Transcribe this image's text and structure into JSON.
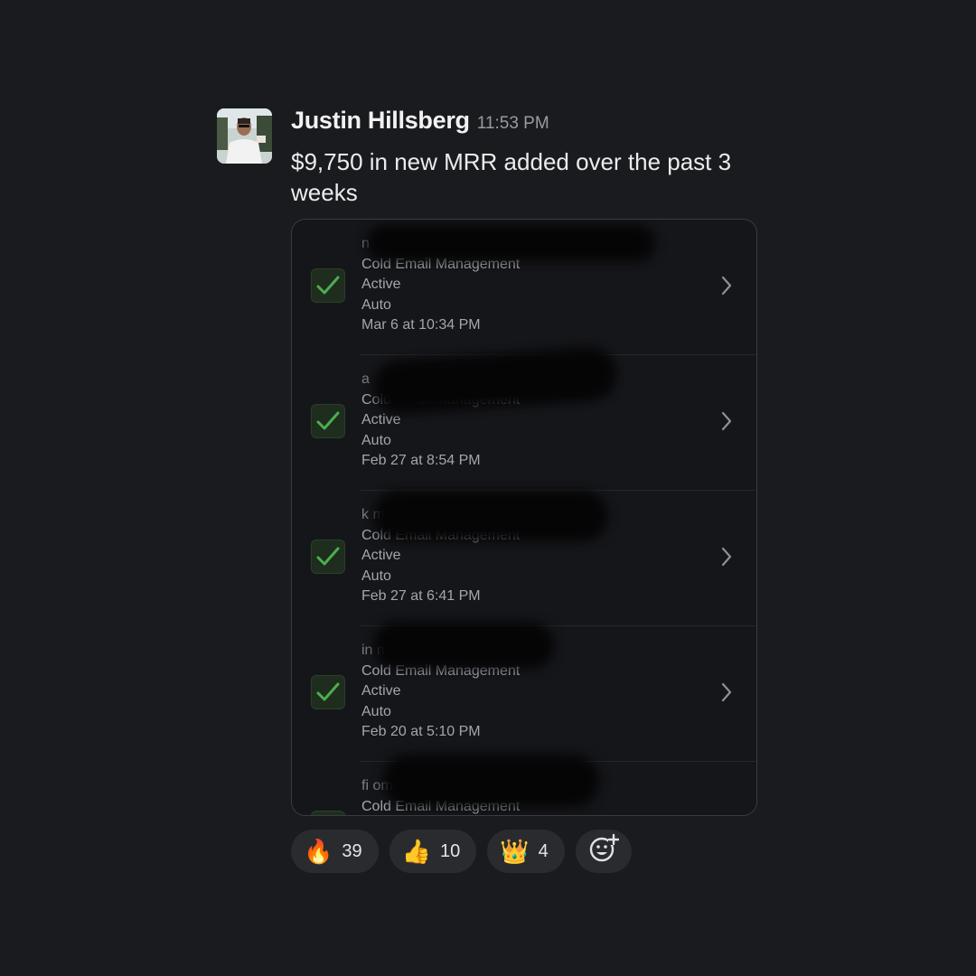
{
  "message": {
    "author": "Justin Hillsberg",
    "time": "11:53 PM",
    "text": "$9,750 in new MRR added over the past 3 weeks"
  },
  "attachment": {
    "rows": [
      {
        "email": "n",
        "service": "Cold Email Management",
        "status": "Active",
        "renewal": "Auto",
        "date": "Mar 6 at 10:34 PM"
      },
      {
        "email": "a",
        "service": "Cold Email Management",
        "status": "Active",
        "renewal": "Auto",
        "date": "Feb 27 at 8:54 PM"
      },
      {
        "email": "k                                            m",
        "service": "Cold Email Management",
        "status": "Active",
        "renewal": "Auto",
        "date": "Feb 27 at 6:41 PM"
      },
      {
        "email": "in                                      m",
        "service": "Cold Email Management",
        "status": "Active",
        "renewal": "Auto",
        "date": "Feb 20 at 5:10 PM"
      },
      {
        "email": "fi                                          om",
        "service": "Cold Email Management",
        "status": "",
        "renewal": "",
        "date": ""
      }
    ]
  },
  "reactions": [
    {
      "emoji": "🔥",
      "count": "39",
      "icon": "fire-icon"
    },
    {
      "emoji": "👍",
      "count": "10",
      "icon": "thumbs-up-icon"
    },
    {
      "emoji": "👑",
      "count": "4",
      "icon": "crown-icon"
    }
  ],
  "add_reaction_icon": "add-reaction-icon",
  "colors": {
    "background": "#1a1b1e",
    "check_green": "#4cae4f",
    "pill": "#2a2b2f"
  }
}
